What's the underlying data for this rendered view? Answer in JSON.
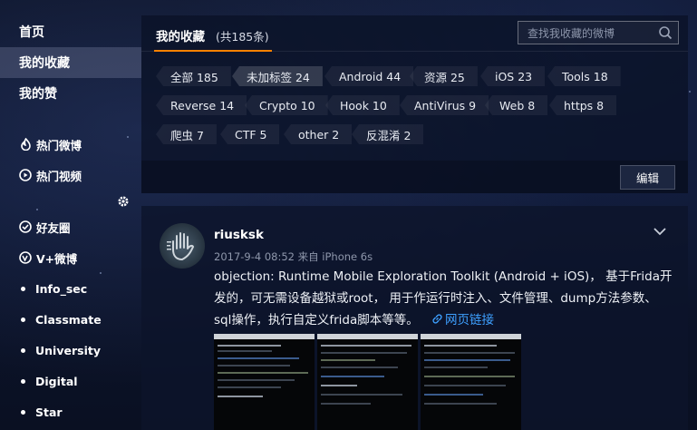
{
  "sidebar": {
    "items": [
      {
        "label": "首页",
        "active": false
      },
      {
        "label": "我的收藏",
        "active": true
      },
      {
        "label": "我的赞",
        "active": false
      }
    ],
    "secondary": [
      {
        "label": "热门微博",
        "icon": "hot-flame-icon"
      },
      {
        "label": "热门视频",
        "icon": "video-play-icon"
      }
    ],
    "groups": [
      {
        "label": "好友圈",
        "icon": "friends-circle-icon"
      },
      {
        "label": "V+微博",
        "icon": "vplus-icon"
      },
      {
        "label": "Info_sec",
        "icon": "dot"
      },
      {
        "label": "Classmate",
        "icon": "dot"
      },
      {
        "label": "University",
        "icon": "dot"
      },
      {
        "label": "Digital",
        "icon": "dot"
      },
      {
        "label": "Star",
        "icon": "dot"
      }
    ]
  },
  "favorites": {
    "title": "我的收藏",
    "count": "(共185条)",
    "search_placeholder": "查找我收藏的微博",
    "tags": [
      {
        "label": "全部 185"
      },
      {
        "label": "未加标签 24",
        "selected": true
      },
      {
        "label": "Android 44"
      },
      {
        "label": "资源 25"
      },
      {
        "label": "iOS 23"
      },
      {
        "label": "Tools 18"
      },
      {
        "label": "Reverse 14"
      },
      {
        "label": "Crypto 10"
      },
      {
        "label": "Hook 10"
      },
      {
        "label": "AntiVirus 9"
      },
      {
        "label": "Web 8"
      },
      {
        "label": "https 8"
      },
      {
        "label": "爬虫 7"
      },
      {
        "label": "CTF 5"
      },
      {
        "label": "other 2"
      },
      {
        "label": "反混淆 2"
      }
    ],
    "edit_label": "编辑"
  },
  "post": {
    "username": "riusksk",
    "meta": "2017-9-4 08:52 来自 iPhone 6s",
    "content": "objection: Runtime Mobile Exploration Toolkit (Android + iOS)， 基于Frida开发的，可无需设备越狱或root， 用于作运行时注入、文件管理、dump方法参数、sql操作，执行自定义frida脚本等等。",
    "link_label": "网页链接"
  },
  "colors": {
    "accent": "#ff8200",
    "link": "#3ea0ff",
    "panel_bg": "#0a1226"
  }
}
